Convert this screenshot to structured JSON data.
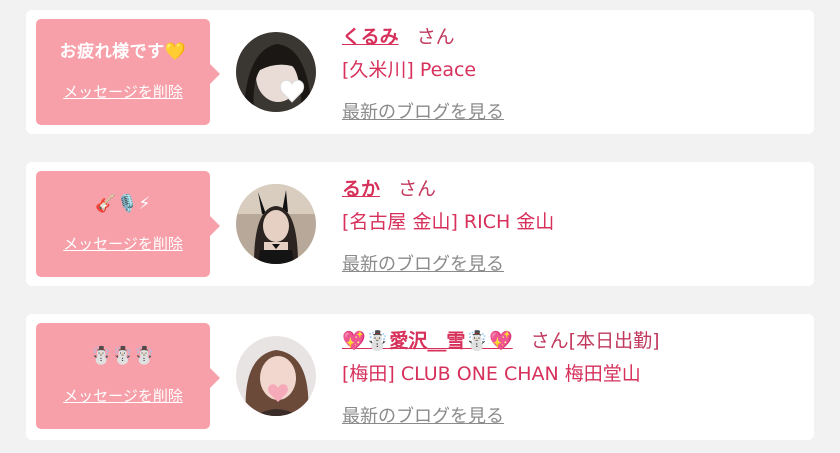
{
  "cards": [
    {
      "message": "お疲れ様です💛",
      "delete_label": "メッセージを削除",
      "name": "くるみ",
      "honorific": "さん",
      "status": "",
      "shop": "[久米川] Peace",
      "blog_label": "最新のブログを見る"
    },
    {
      "message": "🎸🎙️⚡",
      "delete_label": "メッセージを削除",
      "name": "るか",
      "honorific": "さん",
      "status": "",
      "shop": "[名古屋 金山] RICH 金山",
      "blog_label": "最新のブログを見る"
    },
    {
      "message": "☃️☃️☃️",
      "delete_label": "メッセージを削除",
      "name": "💖☃️愛沢__雪☃️💖",
      "honorific": "さん",
      "status": "[本日出勤]",
      "shop": "[梅田] CLUB ONE CHAN 梅田堂山",
      "blog_label": "最新のブログを見る"
    }
  ],
  "colors": {
    "bubble": "#f7a0aa",
    "name": "#d6305b",
    "link_gray": "#8b8b8b",
    "background": "#f2f2f2"
  }
}
